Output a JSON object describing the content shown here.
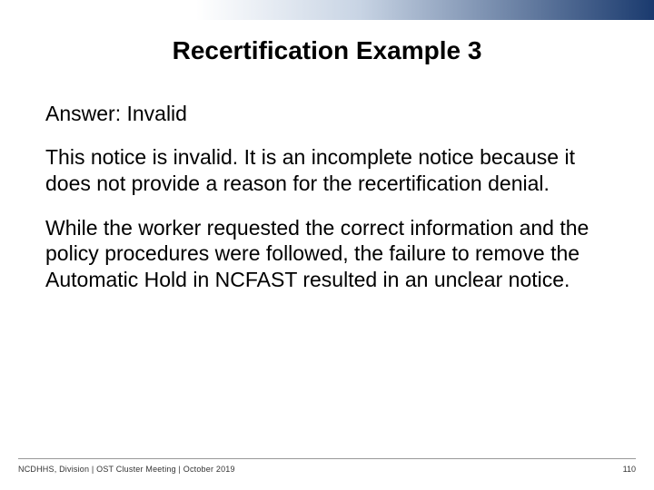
{
  "title": "Recertification Example 3",
  "answer": "Answer: Invalid",
  "para1": "This notice is invalid. It is an incomplete notice because it does not provide a reason for the recertification denial.",
  "para2": "While the worker requested the correct information and the policy procedures were followed, the failure to remove the Automatic Hold in NCFAST resulted in an unclear notice.",
  "footer": {
    "left": "NCDHHS, Division | OST Cluster Meeting | October 2019",
    "page": "110"
  }
}
